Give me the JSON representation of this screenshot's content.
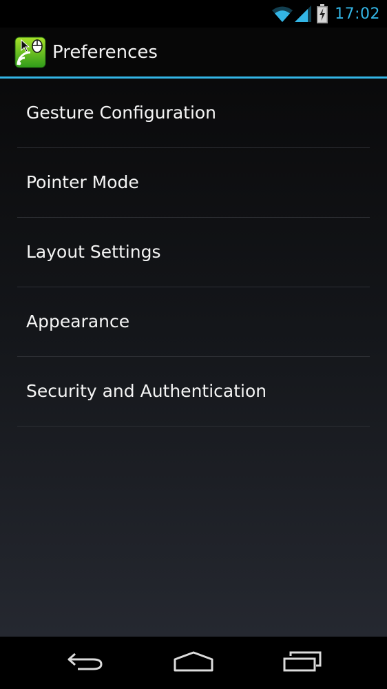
{
  "status_bar": {
    "time": "17:02",
    "icons": [
      "wifi-icon",
      "signal-icon",
      "battery-charging-icon"
    ],
    "accent_color": "#33b5e5"
  },
  "action_bar": {
    "title": "Preferences",
    "icon": "remote-mouse-app-icon",
    "divider_color": "#33b5e5"
  },
  "preferences": {
    "items": [
      {
        "label": "Gesture Configuration"
      },
      {
        "label": "Pointer Mode"
      },
      {
        "label": "Layout Settings"
      },
      {
        "label": "Appearance"
      },
      {
        "label": "Security and Authentication"
      }
    ]
  },
  "nav_bar": {
    "buttons": [
      "back-icon",
      "home-icon",
      "recent-apps-icon"
    ]
  }
}
